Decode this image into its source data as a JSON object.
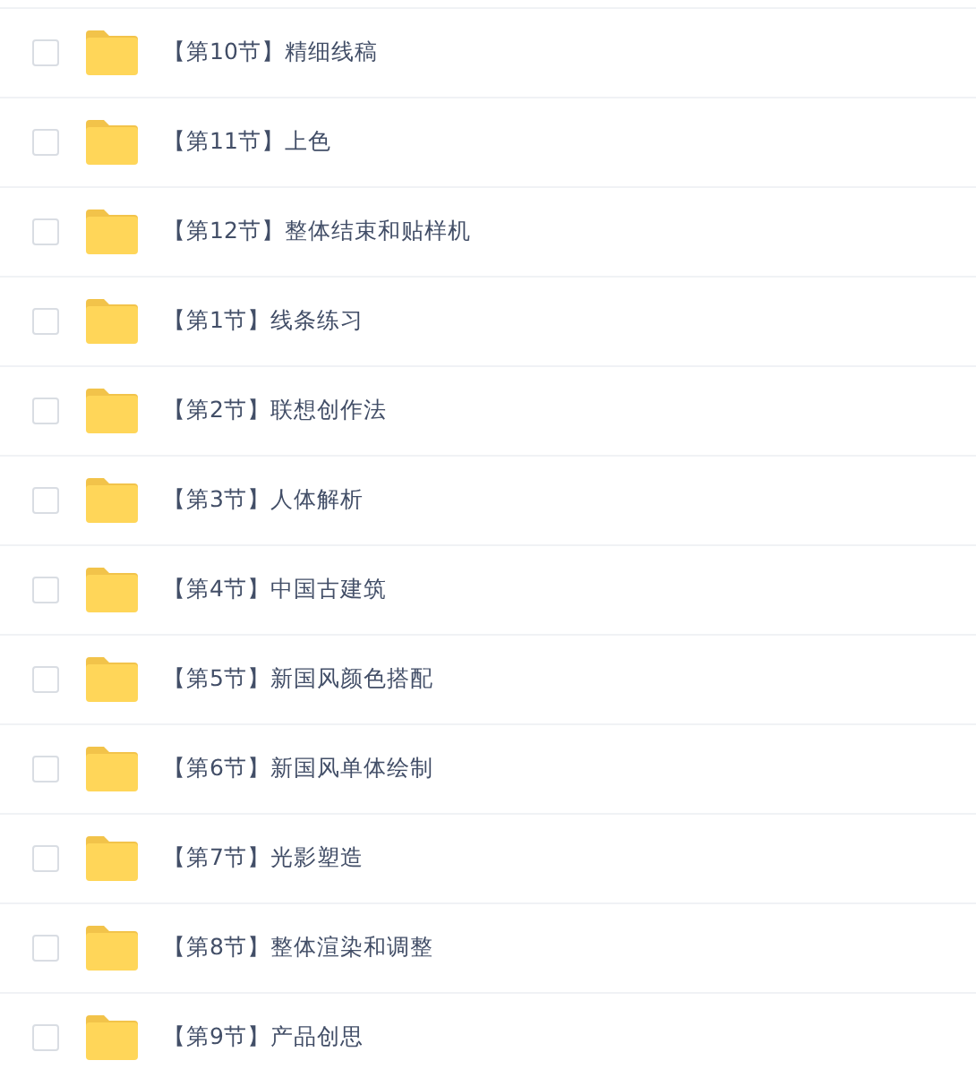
{
  "files": [
    {
      "name": "【第10节】精细线稿",
      "checked": false
    },
    {
      "name": "【第11节】上色",
      "checked": false
    },
    {
      "name": "【第12节】整体结束和贴样机",
      "checked": false
    },
    {
      "name": "【第1节】线条练习",
      "checked": false
    },
    {
      "name": "【第2节】联想创作法",
      "checked": false
    },
    {
      "name": "【第3节】人体解析",
      "checked": false
    },
    {
      "name": "【第4节】中国古建筑",
      "checked": false
    },
    {
      "name": "【第5节】新国风颜色搭配",
      "checked": false
    },
    {
      "name": "【第6节】新国风单体绘制",
      "checked": false
    },
    {
      "name": "【第7节】光影塑造",
      "checked": false
    },
    {
      "name": "【第8节】整体渲染和调整",
      "checked": false
    },
    {
      "name": "【第9节】产品创思",
      "checked": false
    }
  ]
}
